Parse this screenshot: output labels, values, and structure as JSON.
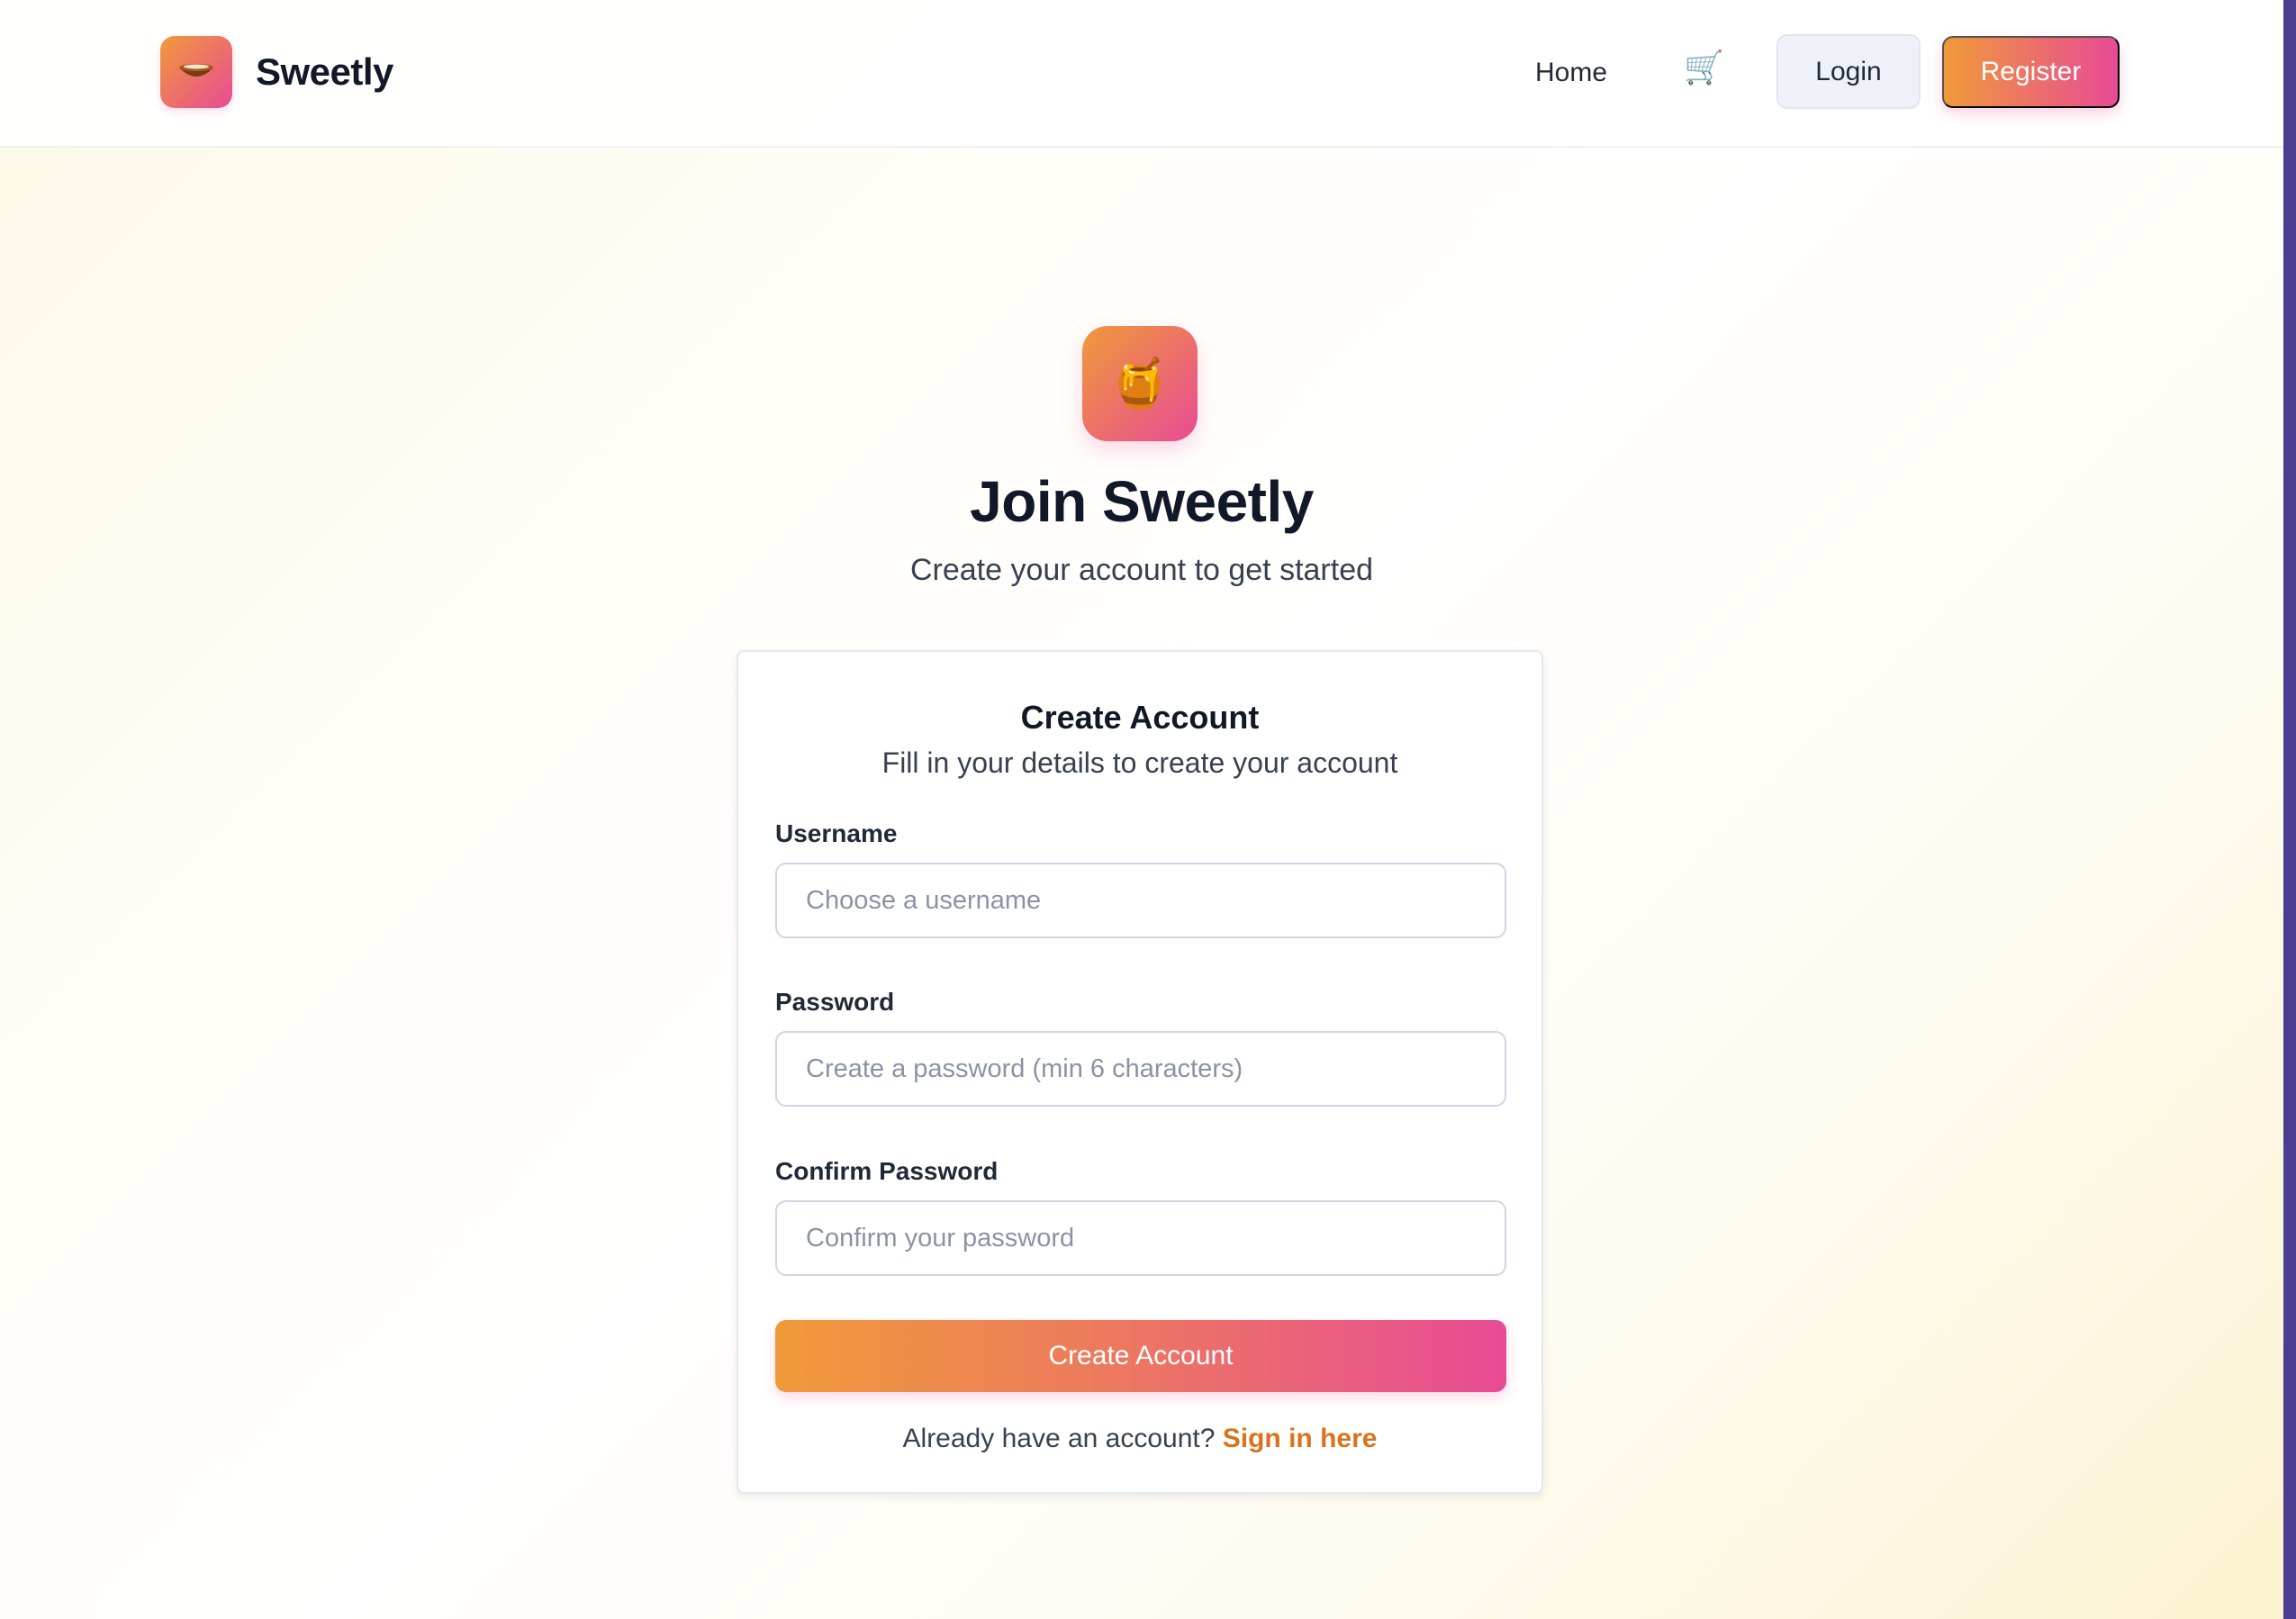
{
  "nav": {
    "brand_icon": "bowl-icon",
    "brand_name": "Sweetly",
    "home_label": "Home",
    "cart_icon": "cart-icon",
    "cart_glyph": "🛒",
    "login_label": "Login",
    "register_label": "Register"
  },
  "hero": {
    "icon": "honey-pot-icon",
    "icon_glyph": "🍯",
    "title": "Join Sweetly",
    "subtitle": "Create your account to get started"
  },
  "form": {
    "title": "Create Account",
    "subtitle": "Fill in your details to create your account",
    "username_label": "Username",
    "username_placeholder": "Choose a username",
    "password_label": "Password",
    "password_placeholder": "Create a password (min 6 characters)",
    "confirm_label": "Confirm Password",
    "confirm_placeholder": "Confirm your password",
    "submit_label": "Create Account",
    "signin_prompt": "Already have an account?",
    "signin_link": "Sign in here"
  },
  "colors": {
    "accent_start": "#f09a3a",
    "accent_end": "#e84a95",
    "link": "#d9731d"
  }
}
